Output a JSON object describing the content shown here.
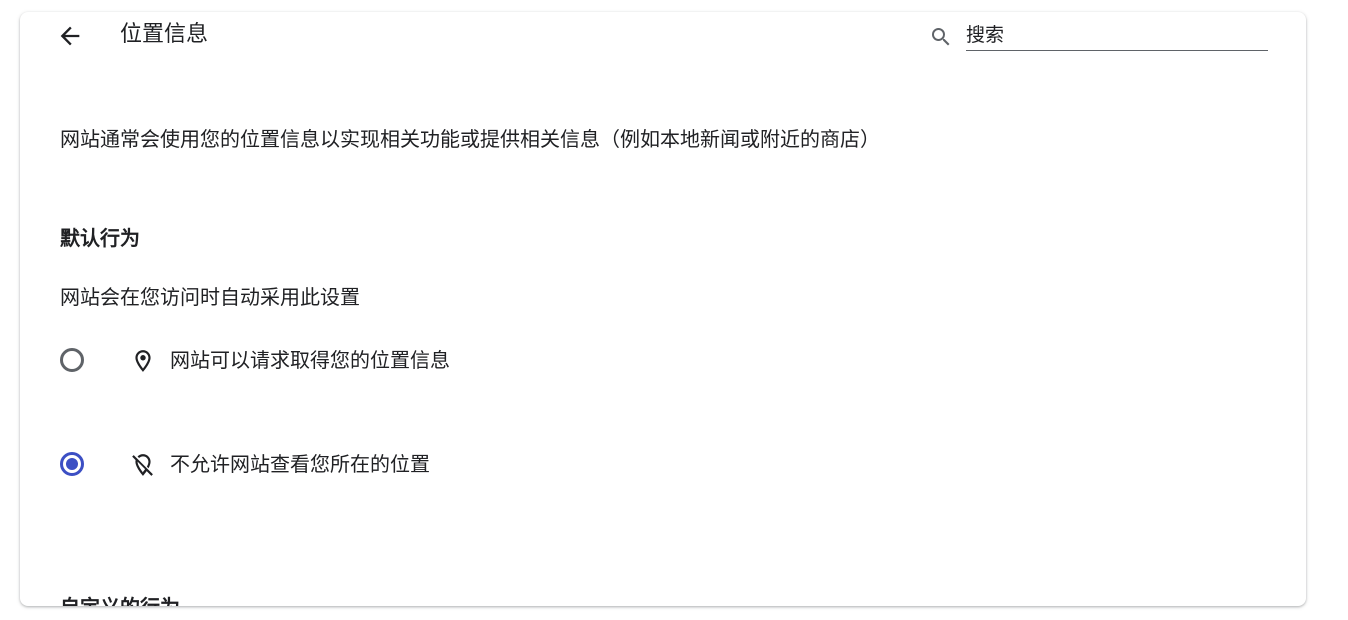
{
  "header": {
    "title": "位置信息",
    "back_icon": "arrow-back-icon",
    "search": {
      "icon": "search-icon",
      "placeholder": "搜索",
      "value": ""
    }
  },
  "description": "网站通常会使用您的位置信息以实现相关功能或提供相关信息（例如本地新闻或附近的商店）",
  "default_behavior": {
    "heading": "默认行为",
    "subtitle": "网站会在您访问时自动采用此设置",
    "options": [
      {
        "label": "网站可以请求取得您的位置信息",
        "icon": "location-pin-icon",
        "selected": false
      },
      {
        "label": "不允许网站查看您所在的位置",
        "icon": "location-off-icon",
        "selected": true
      }
    ]
  },
  "custom_behavior": {
    "heading": "自定义的行为"
  },
  "colors": {
    "accent": "#3c4fc4",
    "text": "#202124",
    "icon_gray": "#5f6368"
  }
}
